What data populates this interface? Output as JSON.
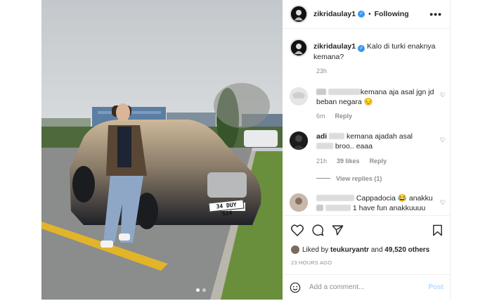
{
  "post": {
    "username": "zikridaulay1",
    "separator": "•",
    "follow_status": "Following",
    "verified": true,
    "more_icon": "more-horizontal-icon"
  },
  "caption": {
    "username": "zikridaulay1",
    "text": "Kalo di turki enaknya kemana?",
    "time": "23h"
  },
  "comments": [
    {
      "text": "kemana aja asal jgn jd beban negara 😔",
      "time": "6m",
      "reply_label": "Reply"
    },
    {
      "username_partial": "adi",
      "text_a": "kemana ajadah asal",
      "text_b": "broo.. eaaa",
      "time": "21h",
      "likes": "39 likes",
      "reply_label": "Reply",
      "view_replies": "View replies (1)"
    },
    {
      "text_a": "Cappadocia 😂 anakku",
      "text_b": "1 have fun anakkuuuu"
    }
  ],
  "likes": {
    "prefix": "Liked by",
    "user": "teukuryantr",
    "and": "and",
    "count": "49,520 others"
  },
  "date": "23 HOURS AGO",
  "composer": {
    "placeholder": "Add a comment...",
    "post_label": "Post"
  },
  "photo": {
    "plate": "34 DUY 524",
    "carousel": {
      "current": 1,
      "total": 2
    }
  },
  "colors": {
    "verified": "#3897f0",
    "post_disabled": "#b3dbff",
    "muted": "#8e8e8e"
  }
}
